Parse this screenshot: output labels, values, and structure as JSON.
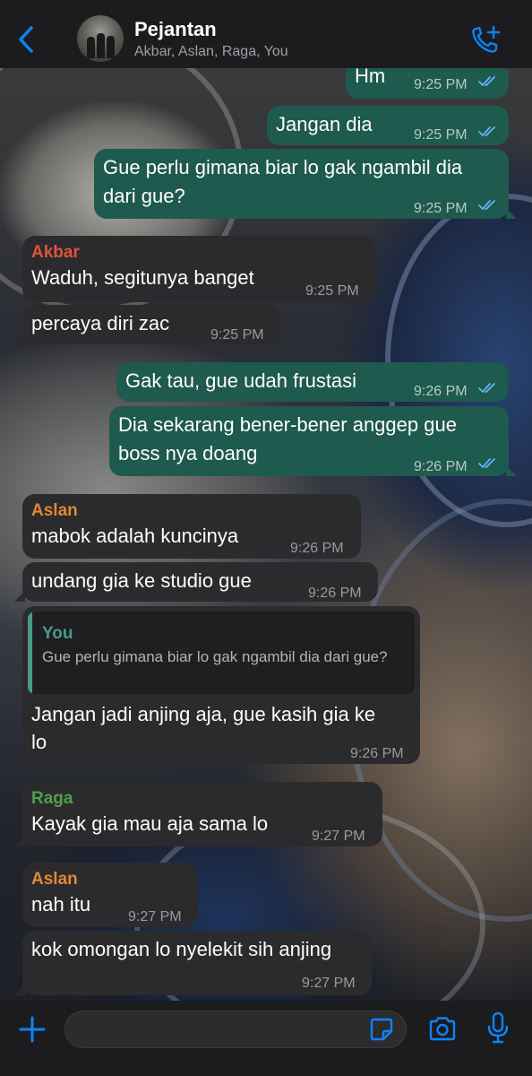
{
  "header": {
    "title": "Pejantan",
    "subtitle": "Akbar, Aslan, Raga, You"
  },
  "colors": {
    "accent": "#0a84ff",
    "outgoing_bubble": "#1e5a4e",
    "incoming_bubble": "#2b2b2d",
    "akbar": "#e0543f",
    "aslan": "#e0873a",
    "raga": "#4fa04a",
    "you_quote": "#4a9a86"
  },
  "messages": [
    {
      "text": "Hm",
      "time": "9:25 PM",
      "dir": "out"
    },
    {
      "text": "Jangan dia",
      "time": "9:25 PM",
      "dir": "out"
    },
    {
      "text_l1": "Gue perlu gimana biar lo gak ngambil dia",
      "text_l2": "dari gue?",
      "time": "9:25 PM",
      "dir": "out"
    },
    {
      "sender": "Akbar",
      "text": "Waduh, segitunya banget",
      "time": "9:25 PM",
      "dir": "in"
    },
    {
      "text": "percaya diri zac",
      "time": "9:25 PM",
      "dir": "in"
    },
    {
      "text": "Gak tau, gue udah frustasi",
      "time": "9:26 PM",
      "dir": "out"
    },
    {
      "text_l1": "Dia sekarang bener-bener anggep gue",
      "text_l2": "boss nya doang",
      "time": "9:26 PM",
      "dir": "out"
    },
    {
      "sender": "Aslan",
      "text": "mabok adalah kuncinya",
      "time": "9:26 PM",
      "dir": "in"
    },
    {
      "text": "undang gia ke studio gue",
      "time": "9:26 PM",
      "dir": "in"
    },
    {
      "quote_name": "You",
      "quote_text": "Gue perlu gimana biar lo gak ngambil dia dari gue?",
      "text_l1": "Jangan jadi anjing aja, gue kasih gia ke",
      "text_l2": "lo",
      "time": "9:26 PM",
      "dir": "in"
    },
    {
      "sender": "Raga",
      "text": "Kayak gia mau aja sama lo",
      "time": "9:27 PM",
      "dir": "in"
    },
    {
      "sender": "Aslan",
      "text": "nah itu",
      "time": "9:27 PM",
      "dir": "in"
    },
    {
      "text": "kok omongan lo nyelekit sih anjing",
      "time": "9:27 PM",
      "dir": "in"
    }
  ],
  "icons": {
    "back": "chevron-left-icon",
    "call": "add-call-icon",
    "plus": "plus-icon",
    "sticker": "sticker-icon",
    "camera": "camera-icon",
    "mic": "microphone-icon"
  }
}
